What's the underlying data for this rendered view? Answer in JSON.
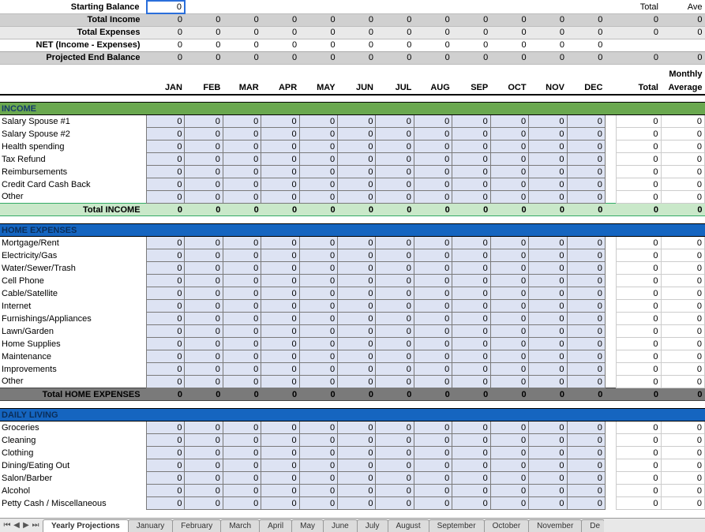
{
  "summary": {
    "starting_label": "Starting Balance",
    "starting_val": "0",
    "total_income_label": "Total Income",
    "total_expenses_label": "Total Expenses",
    "net_label": "NET (Income - Expenses)",
    "projected_label": "Projected End Balance",
    "total_hdr": "Total",
    "ave_hdr": "Ave"
  },
  "months": [
    "JAN",
    "FEB",
    "MAR",
    "APR",
    "MAY",
    "JUN",
    "JUL",
    "AUG",
    "SEP",
    "OCT",
    "NOV",
    "DEC"
  ],
  "col_hdr": {
    "total": "Total",
    "monthly": "Monthly",
    "average": "Average"
  },
  "zeros12": [
    "0",
    "0",
    "0",
    "0",
    "0",
    "0",
    "0",
    "0",
    "0",
    "0",
    "0",
    "0"
  ],
  "zero": "0",
  "sections": {
    "income": {
      "title": "INCOME",
      "rows": [
        "Salary Spouse #1",
        "Salary Spouse #2",
        "Health spending",
        "Tax Refund",
        "Reimbursements",
        "Credit Card Cash Back",
        "Other"
      ],
      "total_label": "Total INCOME"
    },
    "home": {
      "title": "HOME EXPENSES",
      "rows": [
        "Mortgage/Rent",
        "Electricity/Gas",
        "Water/Sewer/Trash",
        "Cell Phone",
        "Cable/Satellite",
        "Internet",
        "Furnishings/Appliances",
        "Lawn/Garden",
        "Home Supplies",
        "Maintenance",
        "Improvements",
        "Other"
      ],
      "total_label": "Total HOME EXPENSES"
    },
    "daily": {
      "title": "DAILY LIVING",
      "rows": [
        "Groceries",
        "Cleaning",
        "Clothing",
        "Dining/Eating Out",
        "Salon/Barber",
        "Alcohol",
        "Petty Cash / Miscellaneous"
      ]
    }
  },
  "tabs": {
    "nav": {
      "first": "⏮",
      "prev": "◀",
      "next": "▶",
      "last": "⏭"
    },
    "list": [
      "Yearly Projections",
      "January",
      "February",
      "March",
      "April",
      "May",
      "June",
      "July",
      "August",
      "September",
      "October",
      "November",
      "De"
    ],
    "active": "Yearly Projections"
  }
}
